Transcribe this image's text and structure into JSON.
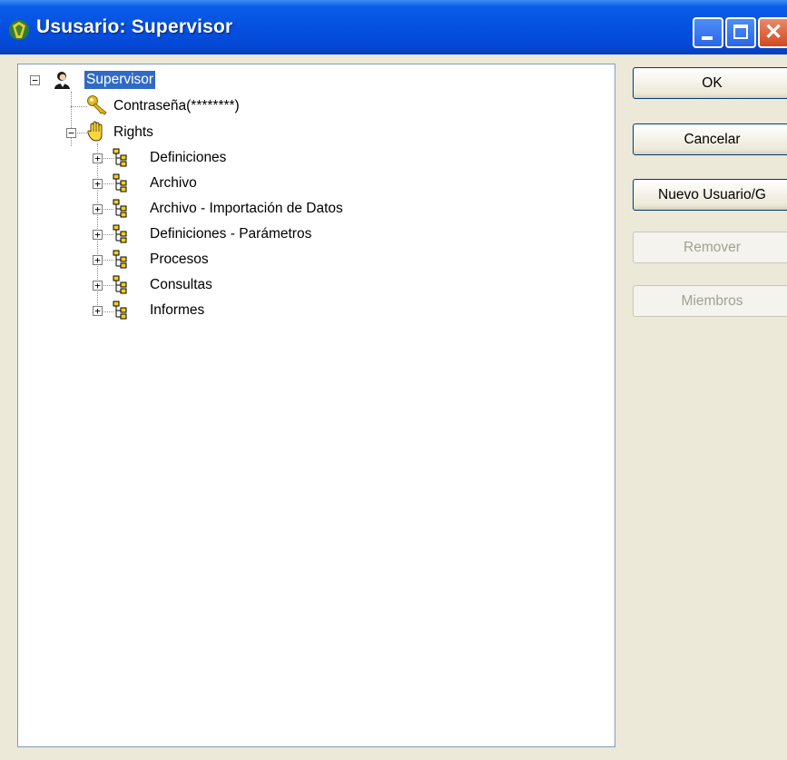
{
  "window": {
    "title": "Ususario: Supervisor"
  },
  "tree": {
    "root_label": "Supervisor",
    "password_label": "Contraseña(********)",
    "rights_label": "Rights",
    "rights_children": [
      {
        "label": "Definiciones"
      },
      {
        "label": "Archivo"
      },
      {
        "label": "Archivo - Importación de Datos"
      },
      {
        "label": "Definiciones - Parámetros"
      },
      {
        "label": "Procesos"
      },
      {
        "label": "Consultas"
      },
      {
        "label": "Informes"
      }
    ]
  },
  "buttons": {
    "ok": "OK",
    "cancel": "Cancelar",
    "new_user": "Nuevo Usuario/G",
    "remove": "Remover",
    "members": "Miembros"
  },
  "colors": {
    "titlebar": "#0550e0",
    "selection": "#316ac5",
    "background": "#ece9d8"
  }
}
